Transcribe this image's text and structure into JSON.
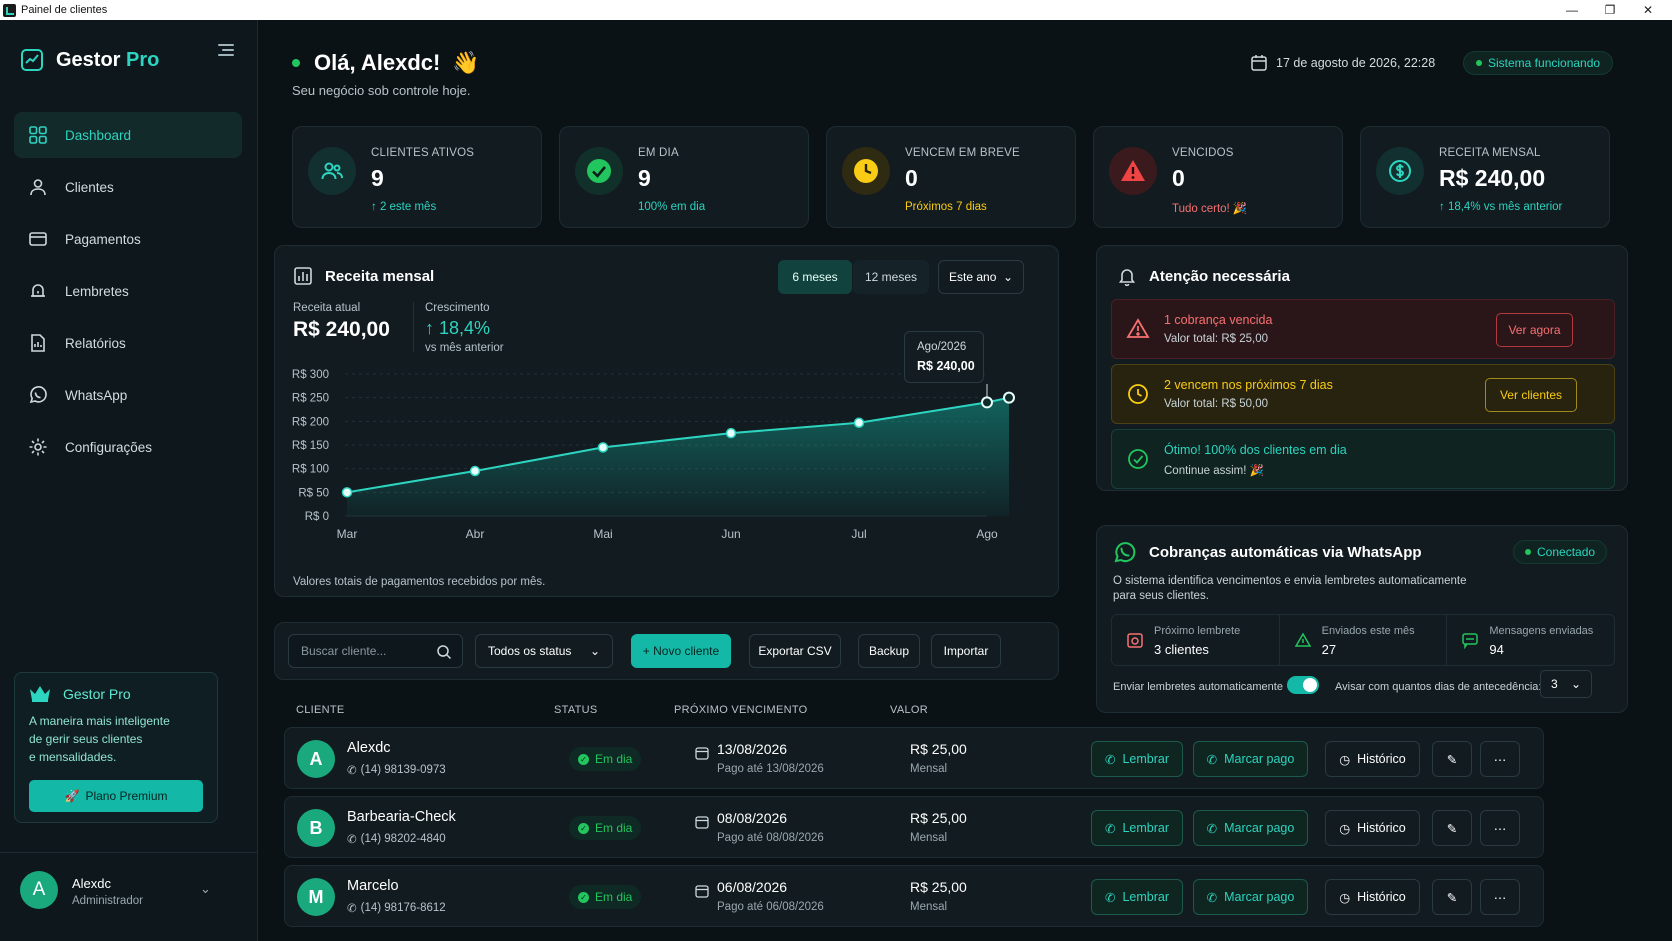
{
  "window": {
    "title": "Painel de clientes"
  },
  "brand": {
    "name": "Gestor",
    "accent": "Pro"
  },
  "nav": {
    "items": [
      {
        "label": "Dashboard"
      },
      {
        "label": "Clientes"
      },
      {
        "label": "Pagamentos"
      },
      {
        "label": "Lembretes"
      },
      {
        "label": "Relatórios"
      },
      {
        "label": "WhatsApp"
      },
      {
        "label": "Configurações"
      }
    ]
  },
  "promo": {
    "title": "Gestor Pro",
    "line1": "A maneira mais inteligente",
    "line2": "de gerir seus clientes",
    "line3": "e mensalidades.",
    "button": "Plano Premium"
  },
  "user": {
    "initial": "A",
    "name": "Alexdc",
    "role": "Administrador"
  },
  "header": {
    "greeting": "Olá, Alexdc!",
    "wave": "👋",
    "subtitle": "Seu negócio sob controle hoje.",
    "datetime": "17 de agosto de 2026, 22:28",
    "status": "Sistema funcionando"
  },
  "kpis": [
    {
      "label": "Clientes ativos",
      "value": "9",
      "sub": "↑ 2 este mês",
      "sub_color": "#2dd4bf"
    },
    {
      "label": "Em dia",
      "value": "9",
      "sub": "100% em dia",
      "sub_color": "#2dd4bf"
    },
    {
      "label": "Vencem em breve",
      "value": "0",
      "sub": "Próximos 7 dias",
      "sub_color": "#facc15"
    },
    {
      "label": "Vencidos",
      "value": "0",
      "sub": "Tudo certo! 🎉",
      "sub_color": "#f87171"
    },
    {
      "label": "Receita mensal",
      "value": "R$ 240,00",
      "sub": "↑ 18,4% vs mês anterior",
      "sub_color": "#2dd4bf"
    }
  ],
  "revenue": {
    "title": "Receita mensal",
    "seg_6": "6 meses",
    "seg_12": "12 meses",
    "range": "Este ano",
    "current_label": "Receita atual",
    "current_value": "R$ 240,00",
    "growth_label": "Crescimento",
    "growth_value": "↑ 18,4%",
    "growth_sub": "vs mês anterior",
    "tooltip_label": "Ago/2026",
    "tooltip_value": "R$ 240,00",
    "footnote": "Valores totais de pagamentos recebidos por mês."
  },
  "chart_data": {
    "type": "area",
    "x": [
      "Mar",
      "Abr",
      "Mai",
      "Jun",
      "Jul",
      "Ago"
    ],
    "values": [
      50,
      95,
      145,
      175,
      197,
      240,
      250
    ],
    "ylim": [
      0,
      300
    ],
    "yticks": [
      "R$ 0",
      "R$ 50",
      "R$ 100",
      "R$ 150",
      "R$ 200",
      "R$ 250",
      "R$ 300"
    ],
    "accent": "#2dd4bf"
  },
  "attention": {
    "title": "Atenção necessária",
    "alerts": [
      {
        "title": "1 cobrança vencida",
        "sub": "Valor total: R$ 25,00",
        "button": "Ver agora"
      },
      {
        "title": "2 vencem nos próximos 7 dias",
        "sub": "Valor total: R$ 50,00",
        "button": "Ver clientes"
      },
      {
        "title": "Ótimo! 100% dos clientes em dia",
        "sub": "Continue assim! 🎉"
      }
    ]
  },
  "whatsapp": {
    "title": "Cobranças automáticas via WhatsApp",
    "status": "Conectado",
    "desc1": "O sistema identifica vencimentos e envia lembretes automaticamente",
    "desc2": "para seus clientes.",
    "stats": [
      {
        "label": "Próximo lembrete",
        "value": "3 clientes"
      },
      {
        "label": "Enviados este mês",
        "value": "27"
      },
      {
        "label": "Mensagens enviadas",
        "value": "94"
      }
    ],
    "auto_label": "Enviar lembretes automaticamente",
    "auto_enabled": true,
    "days_label": "Avisar com quantos dias de antecedência:",
    "days_value": "3"
  },
  "toolbar": {
    "search_placeholder": "Buscar cliente...",
    "status_filter": "Todos os status",
    "new": "+ Novo cliente",
    "export": "Exportar CSV",
    "backup": "Backup",
    "import": "Importar"
  },
  "table": {
    "headers": {
      "client": "CLIENTE",
      "status": "STATUS",
      "due": "PRÓXIMO VENCIMENTO",
      "value": "VALOR"
    },
    "actions": {
      "remind": "Lembrar",
      "mark_paid": "Marcar pago",
      "history": "Histórico"
    },
    "rows": [
      {
        "initial": "A",
        "name": "Alexdc",
        "phone": "(14) 98139-0973",
        "status": "Em dia",
        "due": "13/08/2026",
        "due_sub": "Pago até 13/08/2026",
        "value": "R$ 25,00",
        "period": "Mensal"
      },
      {
        "initial": "B",
        "name": "Barbearia-Check",
        "phone": "(14) 98202-4840",
        "status": "Em dia",
        "due": "08/08/2026",
        "due_sub": "Pago até 08/08/2026",
        "value": "R$ 25,00",
        "period": "Mensal"
      },
      {
        "initial": "M",
        "name": "Marcelo",
        "phone": "(14) 98176-8612",
        "status": "Em dia",
        "due": "06/08/2026",
        "due_sub": "Pago até 06/08/2026",
        "value": "R$ 25,00",
        "period": "Mensal"
      }
    ]
  }
}
